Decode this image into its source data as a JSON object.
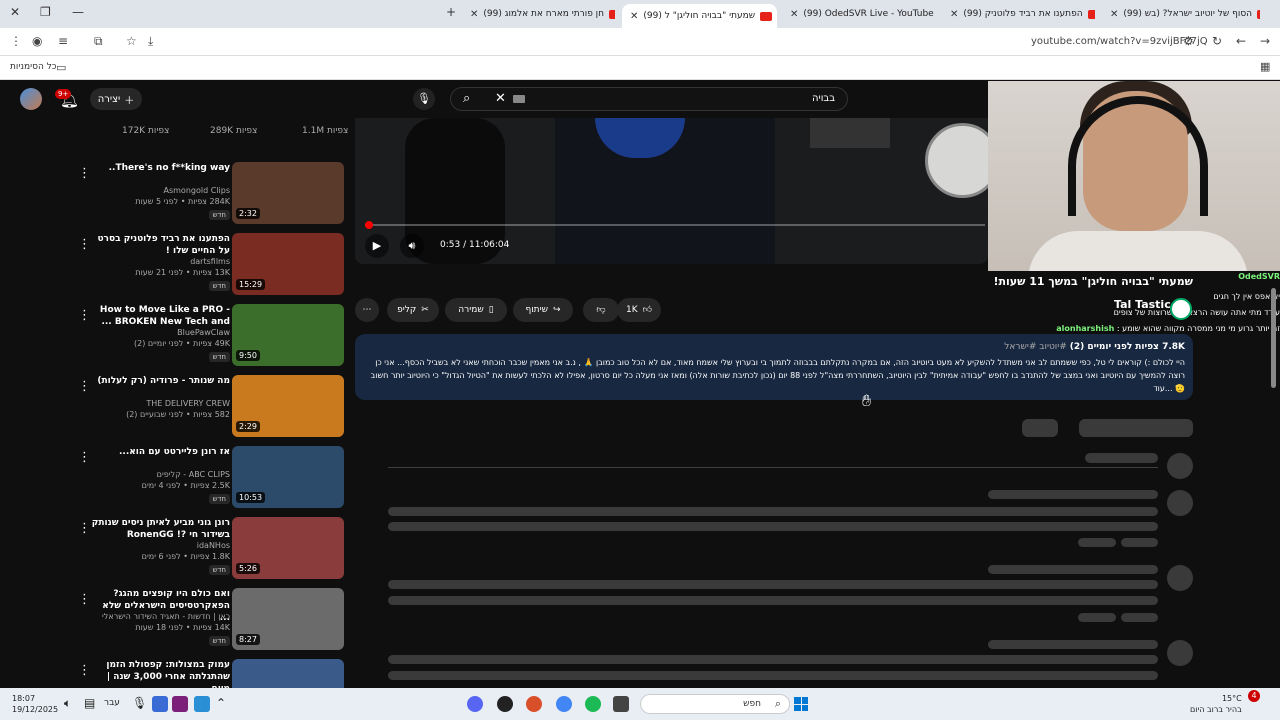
{
  "browser": {
    "tabs": [
      {
        "label": "(99) הסוף של יוטיוב ישראל? (בש"
      },
      {
        "label": "(99) הפתענו את רביד פלוטניק"
      },
      {
        "label": "(99) OdedSVR Live - YouTube"
      },
      {
        "label": "(99) שמעתי \"בבויה חוליגן\" ל"
      },
      {
        "label": "(99) חן פורתי מארח את אלמוג"
      }
    ],
    "url": "youtube.com/watch?v=9zvijBFz7jQ",
    "bookmarks_label": "כל הסימניות"
  },
  "header": {
    "notification_count": "9+",
    "create_label": "יצירה",
    "search_query": "בבויה"
  },
  "top_views": [
    "172K צפיות",
    "289K צפיות",
    "1.1M צפיות"
  ],
  "recommendations": [
    {
      "title": "There's no f**king way..",
      "channel": "Asmongold Clips",
      "meta": "284K צפיות • לפני 5 שעות",
      "badge": "חדש",
      "duration": "2:32",
      "color": "#5a3a2a"
    },
    {
      "title": "הפתענו את רביד פלוטניק בסרט על החיים שלו !",
      "channel": "dartsfilms",
      "meta": "13K צפיות • לפני 21 שעות",
      "badge": "חדש",
      "duration": "15:29",
      "color": "#7a2b22"
    },
    {
      "title": "How to Move Like a PRO - BROKEN New Tech and ...",
      "channel": "BluePawClaw",
      "meta": "49K צפיות • לפני יומיים (2)",
      "badge": "חדש",
      "duration": "9:50",
      "color": "#3b6e2a"
    },
    {
      "title": "מה שנותר - פרודיה (רק לעלות)",
      "channel": "THE DELIVERY CREW",
      "meta": "582 צפיות • לפני שבועיים (2)",
      "badge": "",
      "duration": "2:29",
      "color": "#c97a1e"
    },
    {
      "title": "אז רונן פליירטט עם הוא...",
      "channel": "ABC CLIPS - קליפים",
      "meta": "2.5K צפיות • לפני 4 ימים",
      "badge": "חדש",
      "duration": "10:53",
      "color": "#2c4a6a"
    },
    {
      "title": "רונן גוני מביע לאיתן ניסים שנותק בשידור חי ?! RonenGG",
      "channel": "idaNHos",
      "meta": "1.8K צפיות • לפני 6 ימים",
      "badge": "חדש",
      "duration": "5:26",
      "color": "#8a3b3b"
    },
    {
      "title": "ואם כולם היו קופצים מהגג? הפאקרטסיסים הישראלים שלא ...",
      "channel": "כאן | חדשות - תאגיד השידור הישראלי",
      "meta": "14K צפיות • לפני 18 שעות",
      "badge": "חדש",
      "duration": "8:27",
      "color": "#6b6b6b"
    },
    {
      "title": "עמוק במצולות: קפסולת הזמן שהתגלתה אחרי 3,000 שנה | מיוח...",
      "channel": "",
      "meta": "",
      "badge": "",
      "duration": "",
      "color": "#3a5a8a"
    }
  ],
  "player": {
    "time": "0:53 / 11:06:04",
    "progress": 0.0013
  },
  "video": {
    "title": "שמעתי \"בבויה חוליגן\" במשך 11 שעות!",
    "stats_views": "7.8K צפיות",
    "stats_date": "לפני יומיים (2)",
    "tags": "#יוטיוב #ישראל",
    "description": "היי לכולם :) קוראים לי טל, כפי ששמתם לב אני משתדל להשקיע לא מעט ביוטיוב הזה, אם במקרה נתקלתם בבבוזה לתמוך בי ובערוץ שלי אשמח מאוד, אם לא הכל טוב כמובן 🙏 , נ.ב אני מאמין שכבר הוכחתי שאני לא בשביל הכסף... אני כן רוצה להמשיך עם היוטיוב ואני במצב של להתנדב בו לחפש \"עבודה אמיתית\" לבין היוטיוב, השתחררתי מצה\"ל לפני 88 יום (נכון לכתיבת שורות אלה) ומאז אני מעלה כל יום סרטון, אפילו לא הלכתי לעשות את \"הטיול הגדול\" כי היוטיוב יותר חשוב 🫡 ...עוד",
    "more": "עוד"
  },
  "actions": {
    "like_count": "1K",
    "share": "שיתוף",
    "save": "שמירה",
    "clip": "קליפ"
  },
  "overlay": {
    "streamer_name": "Tal Tastic",
    "chat": [
      {
        "user": "OdedSVR",
        "text": ""
      },
      {
        "user": "",
        "text": "יא אפס אין לך חגים"
      },
      {
        "user": "",
        "text": "עודד מתי אתה עושה הרצאה כנשרוצות של צופים"
      },
      {
        "user": "alonharshish",
        "text": "זה יותר גרוע מי מני ממסרה מקווה שהוא שומע"
      }
    ]
  },
  "taskbar": {
    "time": "18:07",
    "date": "19/12/2025",
    "lang": "עבר",
    "search_label": "חפש",
    "weather_temp": "15°C",
    "weather_desc": "בהיר ברוב היום",
    "notif_count": "4"
  }
}
